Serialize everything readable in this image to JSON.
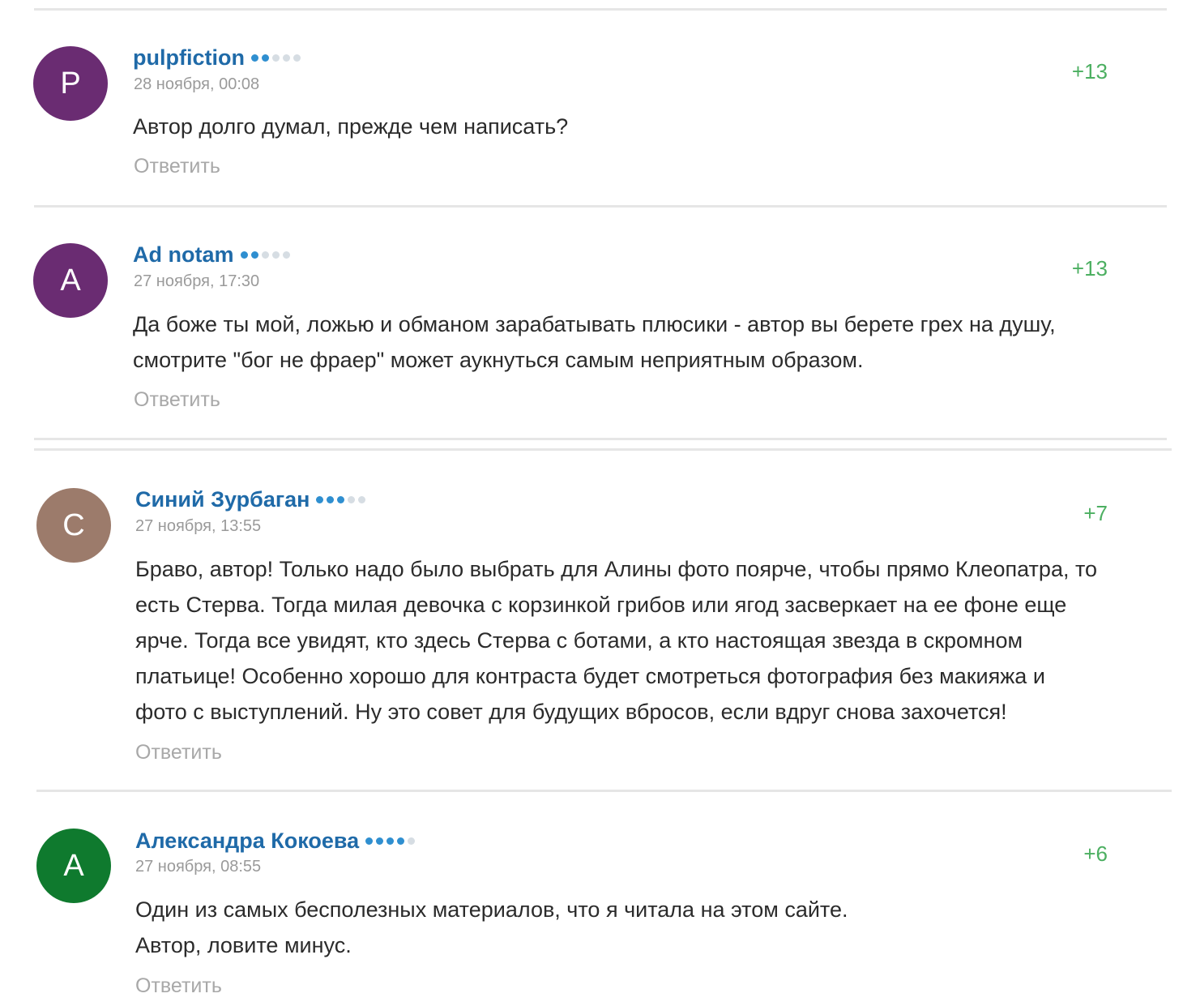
{
  "comments": [
    {
      "author": "pulpfiction",
      "avatar_letter": "P",
      "avatar_color": "#6a2c72",
      "rating_dots_filled": 2,
      "rating_dots_total": 5,
      "date": "28 ноября, 00:08",
      "score": "+13",
      "lines": [
        "Автор долго думал, прежде чем написать?"
      ],
      "reply_label": "Ответить"
    },
    {
      "author": "Ad notam",
      "avatar_letter": "A",
      "avatar_color": "#6a2c72",
      "rating_dots_filled": 2,
      "rating_dots_total": 5,
      "date": "27 ноября, 17:30",
      "score": "+13",
      "lines": [
        "Да боже ты мой, ложью и обманом зарабатывать плюсики - автор вы берете грех на душу,",
        "смотрите \"бог не фраер\" может аукнуться самым неприятным образом."
      ],
      "reply_label": "Ответить"
    },
    {
      "author": "Синий Зурбаган",
      "avatar_letter": "C",
      "avatar_color": "#9c7b6b",
      "rating_dots_filled": 3,
      "rating_dots_total": 5,
      "date": "27 ноября, 13:55",
      "score": "+7",
      "lines": [
        "Браво, автор! Только надо было выбрать для Алины фото поярче, чтобы прямо Клеопатра, то",
        "есть Стерва. Тогда милая девочка с корзинкой грибов или ягод засверкает на ее фоне еще",
        "ярче. Тогда все увидят, кто здесь Стерва с ботами, а кто настоящая звезда в скромном",
        "платьице!  Особенно хорошо для контраста будет смотреться фотография без макияжа и",
        "фото с выступлений. Ну это совет для будущих вбросов, если вдруг снова захочется!"
      ],
      "reply_label": "Ответить"
    },
    {
      "author": "Александра Кокоева",
      "avatar_letter": "A",
      "avatar_color": "#0f7a2e",
      "rating_dots_filled": 4,
      "rating_dots_total": 5,
      "date": "27 ноября, 08:55",
      "score": "+6",
      "lines": [
        "Один из самых бесполезных материалов, что я читала на этом сайте.",
        "Автор, ловите минус."
      ],
      "reply_label": "Ответить"
    }
  ]
}
